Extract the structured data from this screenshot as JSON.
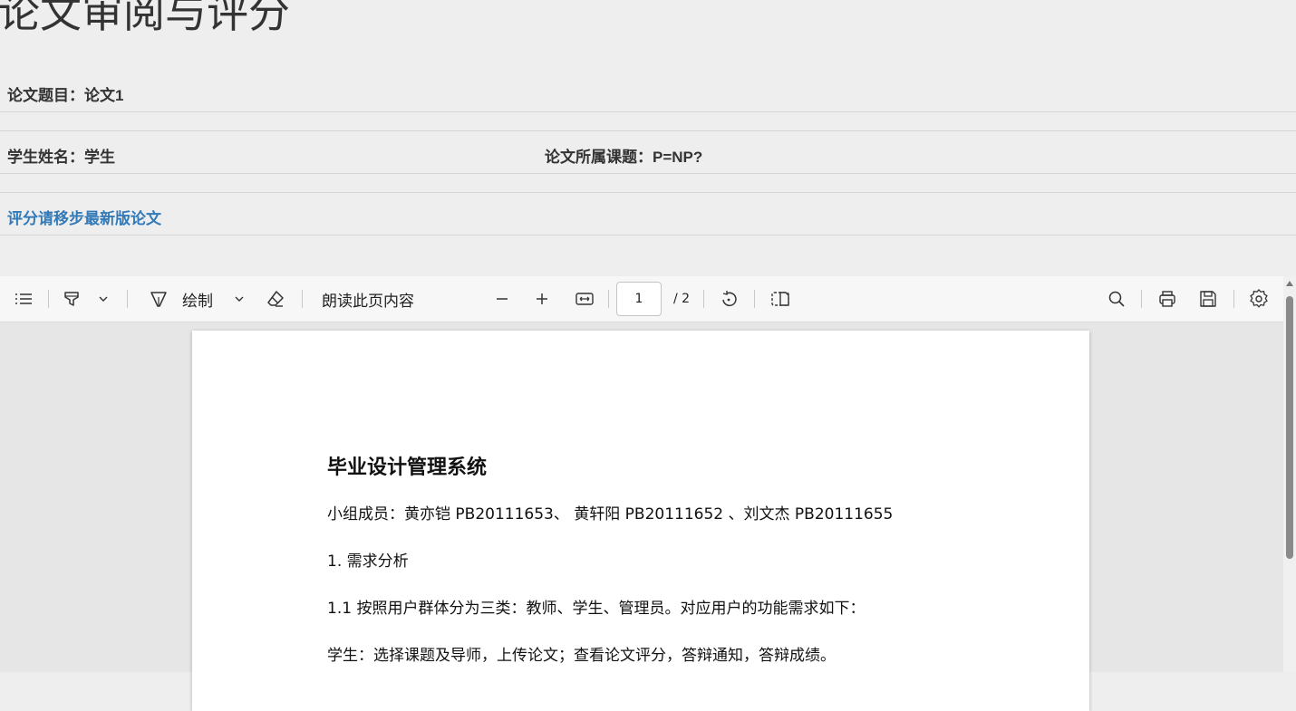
{
  "header": {
    "title": "论文审阅与评分"
  },
  "info": {
    "paper_title": "论文题目：论文1",
    "student_name": "学生姓名：学生",
    "topic": "论文所属课题：P=NP?",
    "latest_link": "评分请移步最新版论文"
  },
  "toolbar": {
    "icons": [
      "contents-icon",
      "highlight-icon",
      "chevron-down-icon",
      "draw-icon",
      "chevron-down-icon",
      "eraser-icon",
      "zoom-out-icon",
      "zoom-in-icon",
      "fit-width-icon",
      "rotate-icon",
      "two-page-icon",
      "search-icon",
      "print-icon",
      "save-icon",
      "settings-icon"
    ],
    "draw_label": "绘制",
    "read_aloud_label": "朗读此页内容",
    "page_current": "1",
    "page_total": "/ 2"
  },
  "pdf": {
    "title": "毕业设计管理系统",
    "members": "小组成员：黄亦铠  PB20111653、  黄轩阳  PB20111652 、刘文杰  PB20111655",
    "section1": "1.   需求分析",
    "section1_1": "1.1 按照用户群体分为三类：教师、学生、管理员。对应用户的功能需求如下：",
    "student_line": "学生：选择课题及导师，上传论文；查看论文评分，答辩通知，答辩成绩。"
  }
}
